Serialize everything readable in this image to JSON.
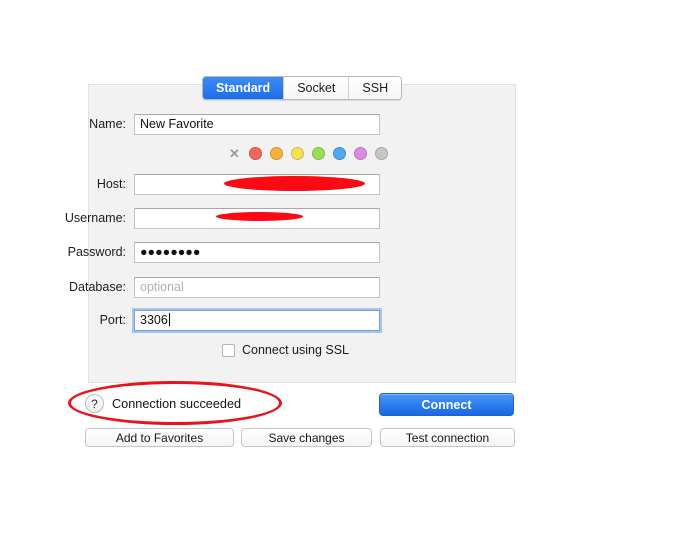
{
  "tabs": [
    {
      "label": "Standard",
      "selected": true
    },
    {
      "label": "Socket",
      "selected": false
    },
    {
      "label": "SSH",
      "selected": false
    }
  ],
  "form": {
    "name": {
      "label": "Name:",
      "value": "New Favorite",
      "placeholder": ""
    },
    "host": {
      "label": "Host:",
      "value": "",
      "placeholder": ""
    },
    "username": {
      "label": "Username:",
      "value": "",
      "placeholder": ""
    },
    "password": {
      "label": "Password:",
      "value": "●●●●●●●●",
      "placeholder": ""
    },
    "database": {
      "label": "Database:",
      "value": "",
      "placeholder": "optional"
    },
    "port": {
      "label": "Port:",
      "value": "3306",
      "placeholder": ""
    }
  },
  "color_swatches": {
    "none_icon": "clear-color-icon",
    "none_glyph": "✕",
    "colors": [
      {
        "name": "red",
        "hex": "#f4675a"
      },
      {
        "name": "orange",
        "hex": "#f8b13c"
      },
      {
        "name": "yellow",
        "hex": "#f2e055"
      },
      {
        "name": "green",
        "hex": "#9ade54"
      },
      {
        "name": "blue",
        "hex": "#4fabf0"
      },
      {
        "name": "magenta",
        "hex": "#e188e4"
      },
      {
        "name": "gray",
        "hex": "#c6c6c6"
      }
    ]
  },
  "ssl": {
    "label": "Connect using SSL",
    "checked": false
  },
  "status": {
    "help_icon": "help-question-icon",
    "help_glyph": "?",
    "text": "Connection succeeded"
  },
  "actions": {
    "connect": "Connect",
    "add_to_favorites": "Add to Favorites",
    "save_changes": "Save changes",
    "test_connection": "Test connection"
  },
  "annotation": {
    "color": "#e8141c",
    "redaction_color": "#fa0a12"
  }
}
